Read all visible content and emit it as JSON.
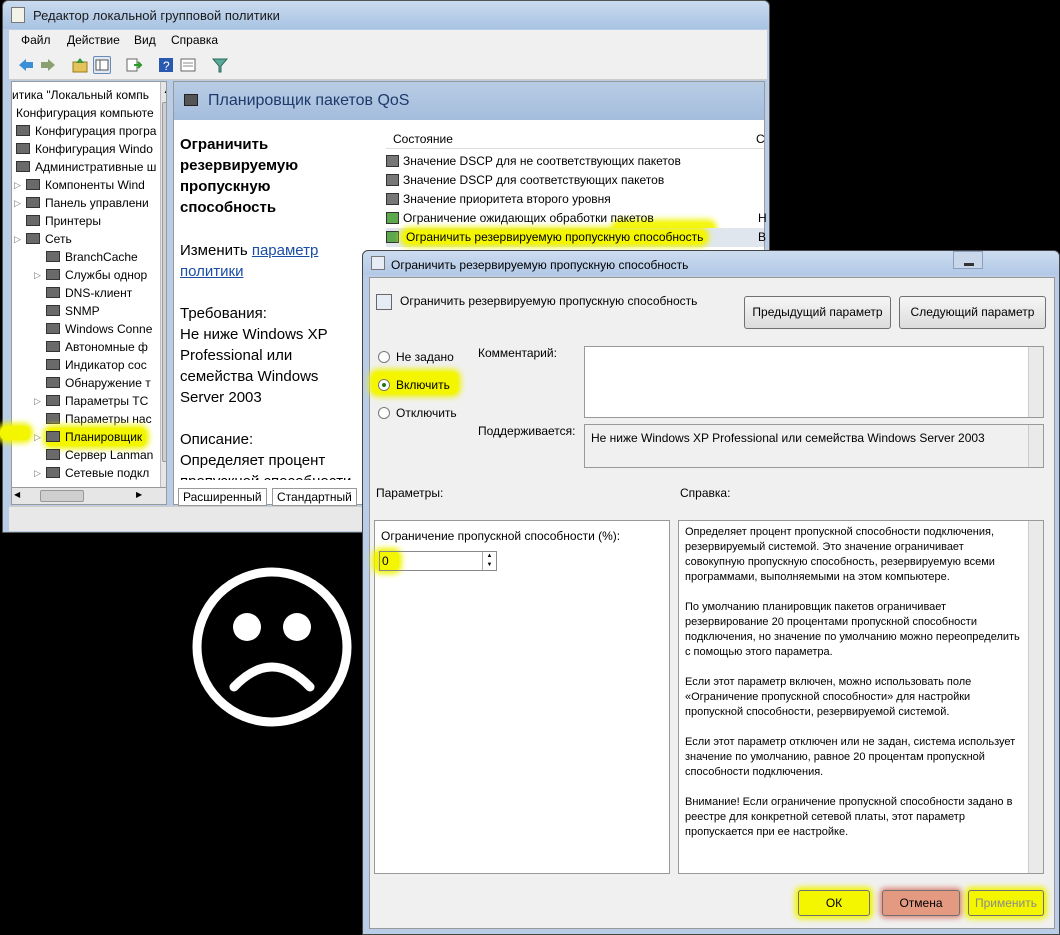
{
  "main_window": {
    "title": "Редактор локальной групповой политики",
    "menu": [
      "Файл",
      "Действие",
      "Вид",
      "Справка"
    ],
    "tree": [
      {
        "label": "итика \"Локальный компь",
        "indent": 0
      },
      {
        "label": "Конфигурация компьюте",
        "indent": 1
      },
      {
        "label": "Конфигурация програ",
        "indent": 2
      },
      {
        "label": "Конфигурация Windo",
        "indent": 2
      },
      {
        "label": "Административные ш",
        "indent": 2
      },
      {
        "label": "Компоненты Wind",
        "indent": 3
      },
      {
        "label": "Панель управлени",
        "indent": 3
      },
      {
        "label": "Принтеры",
        "indent": 3
      },
      {
        "label": "Сеть",
        "indent": 3
      },
      {
        "label": "BranchCache",
        "indent": 4
      },
      {
        "label": "Службы однор",
        "indent": 4
      },
      {
        "label": "DNS-клиент",
        "indent": 4
      },
      {
        "label": "SNMP",
        "indent": 4
      },
      {
        "label": "Windows Conne",
        "indent": 4
      },
      {
        "label": "Автономные ф",
        "indent": 4
      },
      {
        "label": "Индикатор сос",
        "indent": 4
      },
      {
        "label": "Обнаружение т",
        "indent": 4
      },
      {
        "label": "Параметры TC",
        "indent": 4
      },
      {
        "label": "Параметры нас",
        "indent": 4
      },
      {
        "label": "Планировщик",
        "indent": 4
      },
      {
        "label": "Сервер Lanman",
        "indent": 4
      },
      {
        "label": "Сетевые подкл",
        "indent": 4
      }
    ],
    "pane_title": "Планировщик пакетов QoS",
    "description": {
      "title": "Ограничить резервируемую пропускную способность",
      "edit_prefix": "Изменить ",
      "edit_link": "параметр политики",
      "requirements_label": "Требования:",
      "requirements": "Не ниже Windows XP Professional или семейства Windows Server 2003",
      "description_label": "Описание:",
      "description": "Определяет процент пропускной способности"
    },
    "list_header": {
      "state": "Состояние",
      "c2": "С"
    },
    "list": [
      {
        "label": "Значение DSCP для не соответствующих пакетов",
        "tail": ""
      },
      {
        "label": "Значение DSCP для соответствующих пакетов",
        "tail": ""
      },
      {
        "label": "Значение приоритета второго уровня",
        "tail": ""
      },
      {
        "label": "Ограничение ожидающих обработки пакетов",
        "tail": "Н"
      },
      {
        "label": "Ограничить резервируемую пропускную способность",
        "tail": "В"
      }
    ],
    "tabs": [
      "Расширенный",
      "Стандартный"
    ]
  },
  "dialog": {
    "title": "Ограничить резервируемую пропускную способность",
    "setting_name": "Ограничить резервируемую пропускную способность",
    "prev_button": "Предыдущий параметр",
    "next_button": "Следующий параметр",
    "radios": {
      "not_configured": "Не задано",
      "enabled": "Включить",
      "disabled": "Отключить",
      "selected": "enabled"
    },
    "comment_label": "Комментарий:",
    "supported_label": "Поддерживается:",
    "supported_value": "Не ниже Windows XP Professional или семейства Windows Server 2003",
    "params_label": "Параметры:",
    "help_label": "Справка:",
    "option_label": "Ограничение пропускной способности (%):",
    "option_value": "0",
    "help_text": "Определяет процент пропускной способности подключения, резервируемый системой. Это значение ограничивает совокупную пропускную способность, резервируемую всеми программами, выполняемыми на этом компьютере.\n\nПо умолчанию планировщик пакетов ограничивает резервирование 20 процентами пропускной способности подключения, но значение по умолчанию можно переопределить с помощью этого параметра.\n\nЕсли этот параметр включен, можно использовать поле «Ограничение пропускной способности» для настройки пропускной способности, резервируемой системой.\n\nЕсли этот параметр отключен или не задан, система использует значение по умолчанию, равное 20 процентам пропускной способности подключения.\n\nВнимание! Если ограничение пропускной способности задано в реестре для конкретной сетевой платы, этот параметр пропускается при ее настройке.",
    "ok": "ОК",
    "cancel": "Отмена",
    "apply": "Применить"
  },
  "colors": {
    "highlight": "#f4f600",
    "titlebar": "#b9cde6",
    "link": "#1a4ea6"
  },
  "icons": [
    "back-arrow-icon",
    "forward-arrow-icon",
    "up-folder-icon",
    "show-hide-tree-icon",
    "export-icon",
    "help-icon",
    "properties-icon",
    "filter-icon",
    "sad-face-icon"
  ]
}
